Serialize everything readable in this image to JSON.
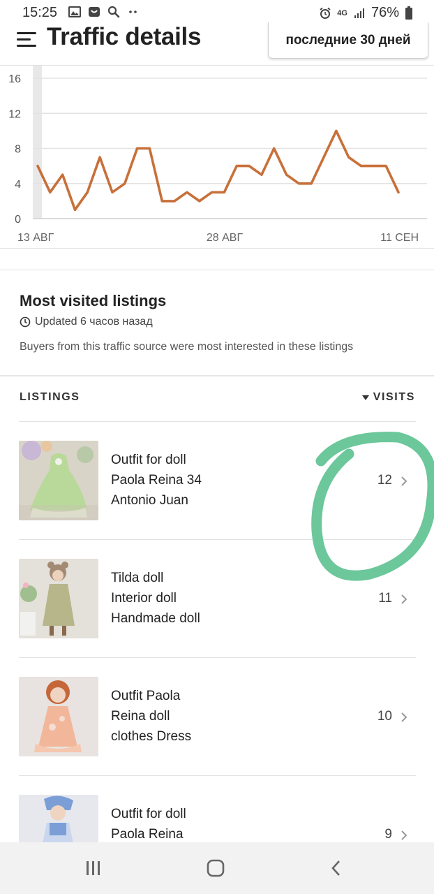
{
  "status_bar": {
    "time": "15:25",
    "network": "4G",
    "battery": "76%",
    "icons": [
      "image-icon",
      "shop-icon",
      "search-icon",
      "more-dots-icon",
      "alarm-icon",
      "signal-icon",
      "battery-icon"
    ]
  },
  "header": {
    "title": "Traffic details",
    "period_label": "последние 30 дней"
  },
  "chart_data": {
    "type": "line",
    "x_tick_labels": [
      "13 АВГ",
      "28 АВГ",
      "11 СЕН"
    ],
    "y_tick_labels": [
      "0",
      "4",
      "8",
      "12",
      "16"
    ],
    "ylim": [
      0,
      16
    ],
    "grid": true,
    "line_color": "#c8703a",
    "series": [
      {
        "values": [
          6,
          3,
          5,
          1,
          3,
          7,
          3,
          4,
          8,
          8,
          2,
          2,
          3,
          2,
          3,
          3,
          6,
          6,
          5,
          8,
          5,
          4,
          4,
          7,
          10,
          7,
          6,
          6,
          6,
          3
        ]
      }
    ]
  },
  "most_visited": {
    "title": "Most visited listings",
    "updated": "Updated 6 часов назад",
    "description": "Buyers from this traffic source were most interested in these listings"
  },
  "table": {
    "col_listings": "LISTINGS",
    "col_visits": "VISITS",
    "rows": [
      {
        "lines": [
          "Outfit for doll",
          "Paola Reina 34",
          "Antonio Juan"
        ],
        "visits": "12"
      },
      {
        "lines": [
          "Tilda doll",
          "Interior doll",
          "Handmade doll"
        ],
        "visits": "11"
      },
      {
        "lines": [
          "Outfit Paola",
          "Reina doll",
          "clothes Dress"
        ],
        "visits": "10"
      },
      {
        "lines": [
          "Outfit for doll",
          "Paola Reina"
        ],
        "visits": "9"
      }
    ]
  },
  "annotation": {
    "color": "#6cc79b"
  },
  "nav_bar": {
    "icons": [
      "recent-apps-icon",
      "home-icon",
      "back-icon"
    ]
  }
}
